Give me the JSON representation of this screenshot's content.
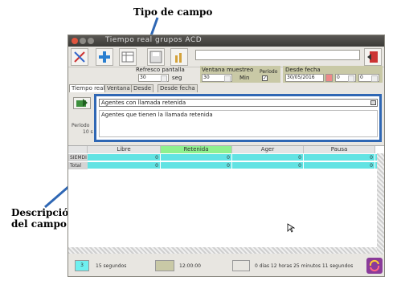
{
  "annotations": {
    "field_type": "Tipo de campo",
    "field_description_line1": "Descripción",
    "field_description_line2": "del campo"
  },
  "window": {
    "title": "Tiempo real grupos ACD"
  },
  "toolbar": {
    "icons": [
      "tools-icon",
      "add-icon",
      "table-icon",
      "save-icon",
      "chart-icon",
      "exit-icon"
    ],
    "search_value": ""
  },
  "params": {
    "refresh_label": "Refresco pantalla",
    "refresh_value": "30",
    "refresh_unit": "seg",
    "window_label": "Ventana muestreo",
    "window_value": "30",
    "window_unit": "Min",
    "period_label": "Período",
    "from_label": "Desde fecha",
    "from_date": "30/05/2016",
    "hour_value": "0",
    "minute_value": "0"
  },
  "tabs": [
    "Tiempo real",
    "Ventana",
    "Desde",
    "Desde fecha"
  ],
  "left_panel": {
    "label1": "Período",
    "label2": "10 s"
  },
  "field": {
    "selected": "Agentes con llamada retenida",
    "description": "Agentes que tienen la llamada retenida"
  },
  "grid": {
    "columns": [
      "Libre",
      "Retenida",
      "Ager",
      "Pausa"
    ],
    "rows": [
      {
        "label": "SIEMDI",
        "values": [
          "0",
          "0",
          "0",
          "0"
        ]
      },
      {
        "label": "Total",
        "values": [
          "0",
          "0",
          "0",
          "0"
        ]
      }
    ]
  },
  "status": {
    "count": "3",
    "interval": "15 segundos",
    "time": "12:00:00",
    "elapsed": "0 días 12 horas 25 minutos 11 segundos"
  },
  "colors": {
    "accent_border": "#2f67b4",
    "row_bg": "#62e3e3",
    "highlight_header": "#8ff08f"
  }
}
